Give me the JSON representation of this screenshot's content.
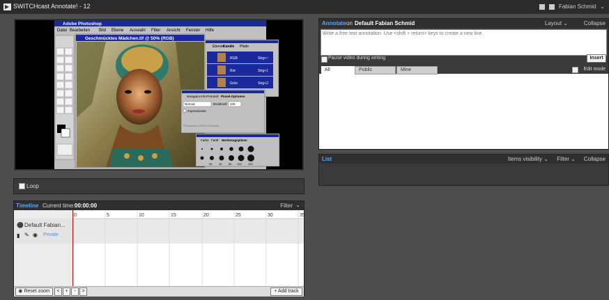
{
  "app": {
    "title": "SWITCHcast Annotate! - 12",
    "user": "Fabian Schmid"
  },
  "video_screen": {
    "app_title": "Adobe Photoshop",
    "menu": [
      "Datei",
      "Bearbeiten",
      "Bild",
      "Ebene",
      "Auswahl",
      "Filter",
      "Ansicht",
      "Fenster",
      "Hilfe"
    ],
    "doc_title": "Geschmücktes Mädchen.tif @ 50% (RGB)",
    "channels_tabs": [
      "Ebenen",
      "Kanäle",
      "Pfade"
    ],
    "channels": [
      {
        "name": "RGB",
        "key": "Strg+~"
      },
      {
        "name": "Rot",
        "key": "Strg+1"
      },
      {
        "name": "Grün",
        "key": "Strg+2"
      }
    ],
    "options_tabs": [
      "Navigator",
      "Info",
      "Protokoll",
      "Pinsel-Optionen"
    ],
    "options": {
      "mode": "Normal",
      "opacity_label": "Deckkraft:",
      "opacity": "100",
      "impressionist": "Impressionist",
      "flags": "Pinselkante  Größe  Deckkraft"
    },
    "brush_tabs": [
      "Farbe",
      "Farbf.",
      "Werkzeugspitzen"
    ],
    "brush_sizes": [
      "35",
      "45",
      "65",
      "100",
      "200"
    ]
  },
  "loop": {
    "label": "Loop"
  },
  "timeline": {
    "title": "Timeline",
    "current_time_label": "Current time:",
    "current_time": "00:00:00",
    "filter": "Filter",
    "ticks": [
      "0",
      "5",
      "10",
      "15",
      "20",
      "25",
      "30",
      "35"
    ],
    "track_name": "Default Fabian...",
    "privacy": "Private",
    "reset_zoom": "Reset zoom",
    "zoom_in": "+",
    "zoom_out": "-",
    "prev": "<",
    "next": ">",
    "add_track": "+ Add track"
  },
  "annotate": {
    "title": "Annotate",
    "on": "on",
    "track": "Default Fabian Schmid",
    "layout": "Layout",
    "collapse": "Collapse",
    "placeholder": "Write a free text annotation. Use <shift + return> keys to create a new line.",
    "pause_label": "Pause video during writing",
    "insert": "Insert",
    "tabs": [
      "All",
      "Public",
      "Mine"
    ],
    "edit_mode": "Edit mode"
  },
  "list": {
    "title": "List",
    "items_visibility": "Items visibility",
    "filter": "Filter",
    "collapse": "Collapse"
  }
}
